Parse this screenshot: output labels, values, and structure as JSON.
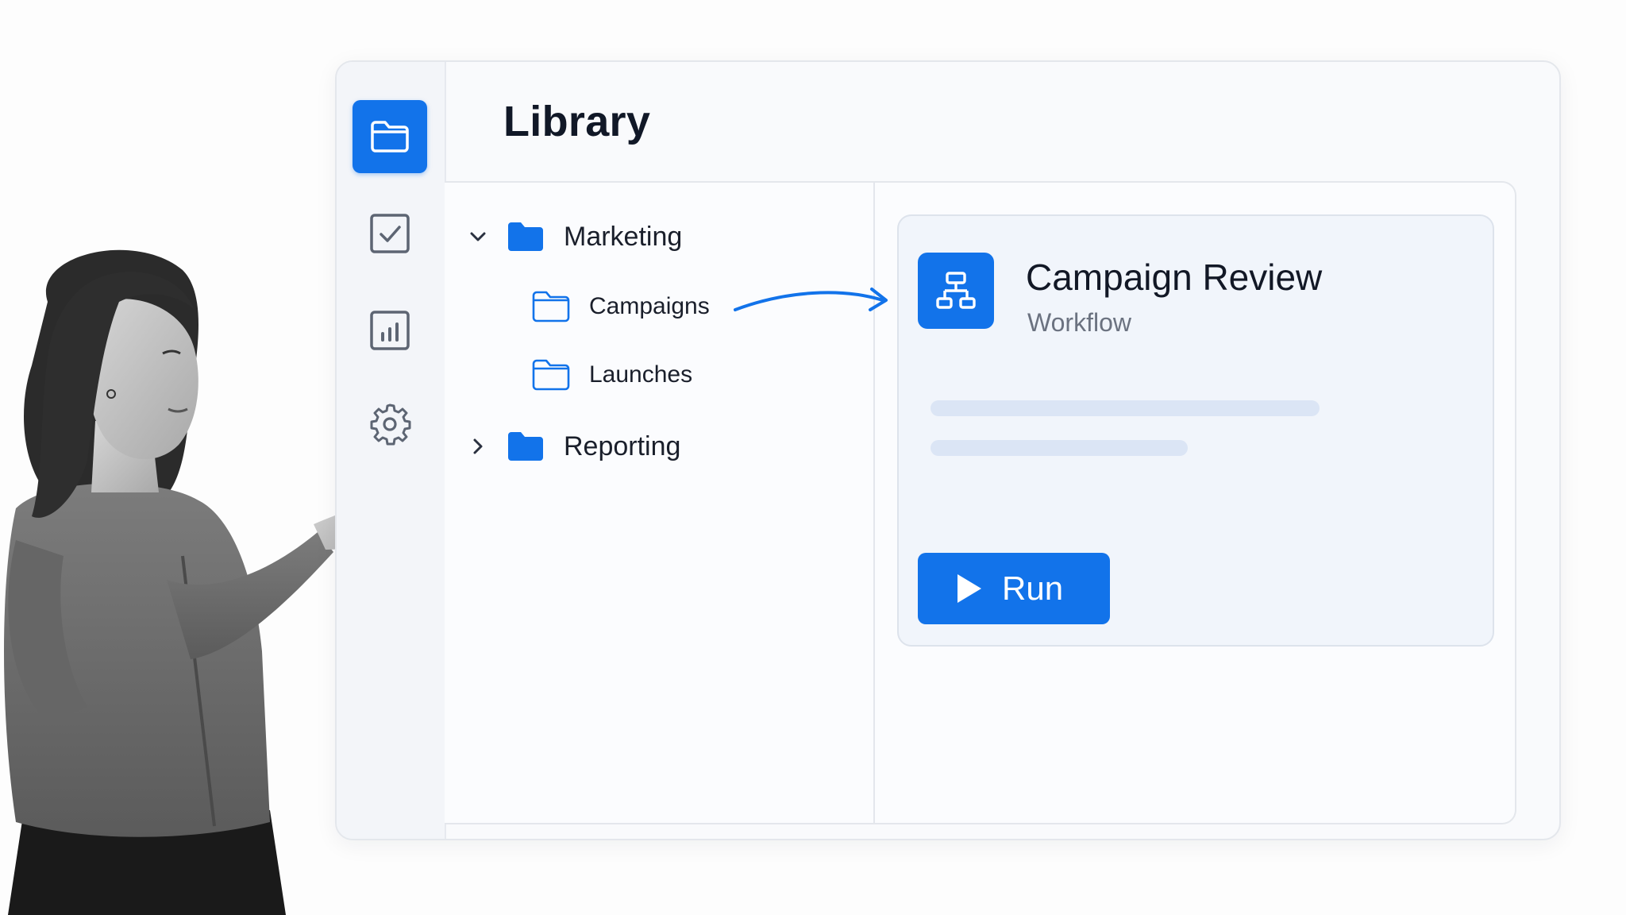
{
  "library": {
    "title": "Library"
  },
  "rail": {
    "items": [
      {
        "icon": "folder-icon",
        "active": true
      },
      {
        "icon": "checkbox-icon",
        "active": false
      },
      {
        "icon": "bar-chart-icon",
        "active": false
      },
      {
        "icon": "gear-icon",
        "active": false
      }
    ]
  },
  "tree": {
    "marketing": {
      "label": "Marketing",
      "expanded": true
    },
    "campaigns": {
      "label": "Campaigns"
    },
    "launches": {
      "label": "Launches"
    },
    "reporting": {
      "label": "Reporting",
      "expanded": false
    }
  },
  "detail": {
    "title": "Campaign Review",
    "subtitle": "Workflow",
    "icon": "workflow-icon",
    "run_label": "Run"
  },
  "colors": {
    "accent": "#1273ea",
    "text": "#1a1f2b",
    "muted": "#6b7280",
    "skeleton": "#dbe5f5"
  }
}
